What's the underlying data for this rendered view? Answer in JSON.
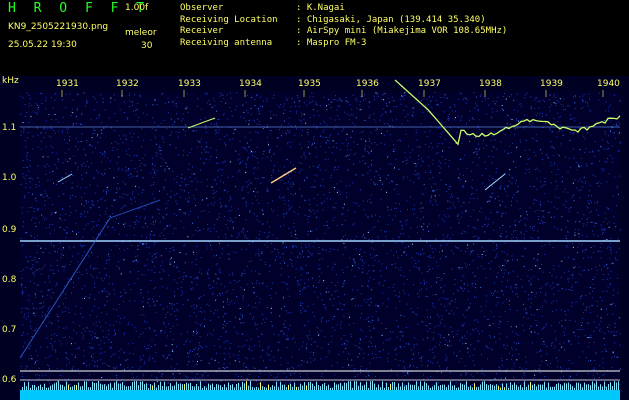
{
  "header": {
    "brand": "H R O F F T",
    "version": "1.00f",
    "filename": "KN9_2505221930.png",
    "datetime": "25.05.22 19:30",
    "meleor_label": "meleor",
    "meleor_value": "30",
    "observer_label": "Observer",
    "observer_value": ": K.Nagai",
    "location_label": "Receiving Location",
    "location_value": ": Chigasaki, Japan (139.414 35.340)",
    "receiver_label": "Receiver",
    "receiver_value": ": AirSpy mini (Miakejima VOR 108.65MHz)",
    "antenna_label": "Receiving antenna",
    "antenna_value": ": Maspro FM-3"
  },
  "axis": {
    "unit": "kHz",
    "yticks": [
      "1.1",
      "1.0",
      "0.9",
      "0.8",
      "0.7",
      "0.6"
    ],
    "xticks": [
      "1931",
      "1932",
      "1933",
      "1934",
      "1935",
      "1936",
      "1937",
      "1938",
      "1939",
      "1940"
    ]
  },
  "colors": {
    "brand": "#22ff22",
    "header_text": "#ffff66",
    "meleor_value": "#ffff66",
    "background": "#000033",
    "noise": "#2a5cff",
    "signal": "#c8ff66",
    "band_bottom": "#00c8ff"
  }
}
